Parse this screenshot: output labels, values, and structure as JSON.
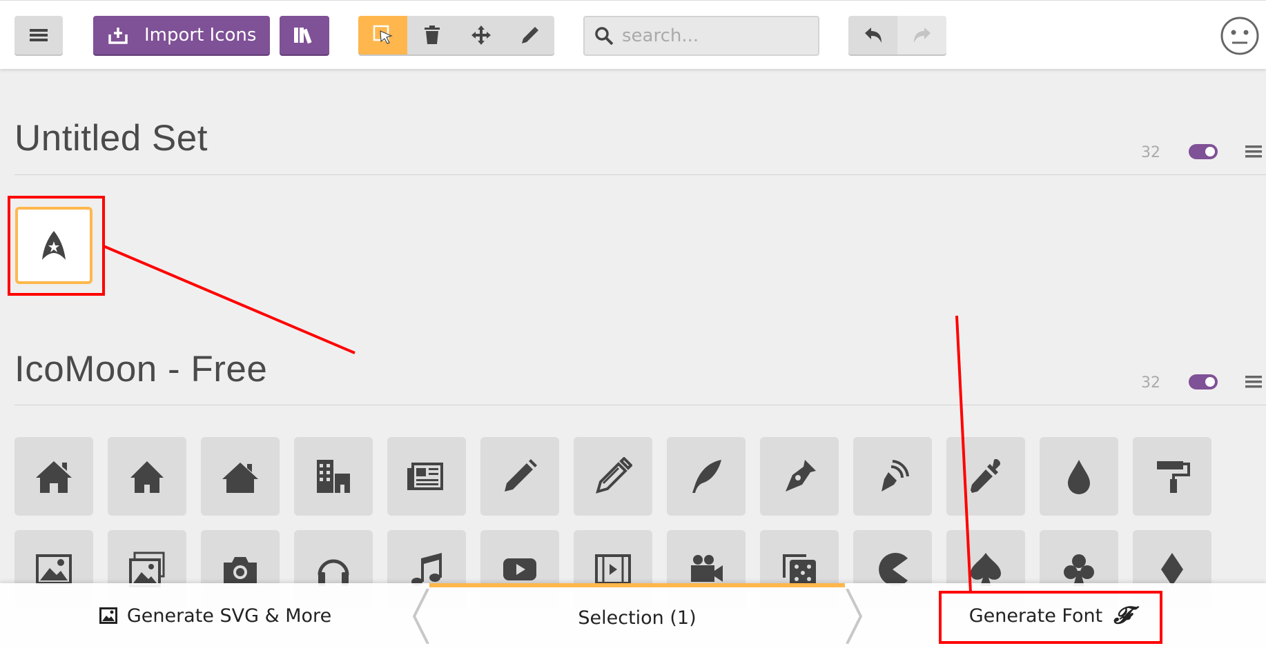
{
  "toolbar": {
    "menu_icon": "hamburger-icon",
    "import_label": "Import Icons",
    "import_icon": "import-icon",
    "library_icon": "library-icon",
    "modes": [
      "select-icon",
      "trash-icon",
      "move-icon",
      "pencil-icon"
    ],
    "active_mode": "select",
    "search_placeholder": "search...",
    "undo_icon": "undo-icon",
    "redo_icon": "redo-icon",
    "user_icon": "neutral-face-icon"
  },
  "sets": [
    {
      "title": "Untitled Set",
      "count": "32",
      "enabled": true
    },
    {
      "title": "IcoMoon - Free",
      "count": "32",
      "enabled": true
    }
  ],
  "selected_icon": "star-trek-icon",
  "icomoon_icons": [
    "home-icon",
    "home2-icon",
    "home3-icon",
    "office-icon",
    "newspaper-icon",
    "pencil-icon",
    "pencil2-icon",
    "quill-icon",
    "pen-icon",
    "blog-icon",
    "eyedropper-icon",
    "droplet-icon",
    "paint-format-icon",
    "image-icon",
    "images-icon",
    "camera-icon",
    "headphones-icon",
    "music-icon",
    "play-icon",
    "film-icon",
    "video-camera-icon",
    "dice-icon",
    "pacman-icon",
    "spades-icon",
    "clubs-icon",
    "diamonds-icon"
  ],
  "bottom": {
    "generate_svg_label": "Generate SVG & More",
    "selection_label": "Selection (1)",
    "generate_font_label": "Generate Font",
    "font_glyph": "𝓕"
  },
  "colors": {
    "accent_purple": "#7f5196",
    "accent_orange": "#ffb74d",
    "annotation_red": "#ff0000"
  }
}
